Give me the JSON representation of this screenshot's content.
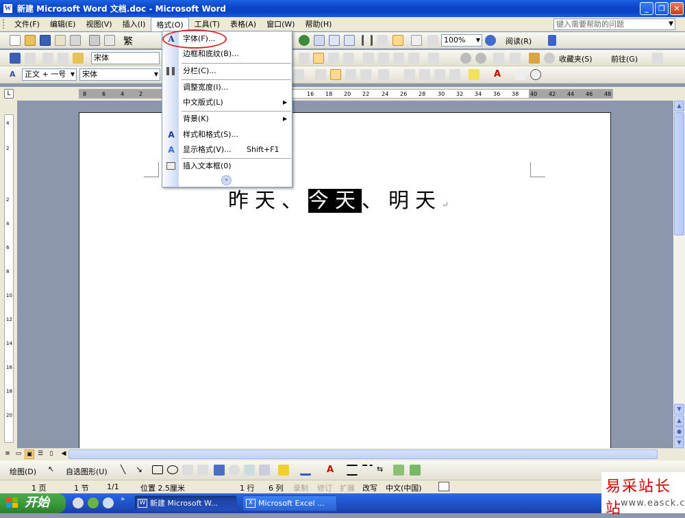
{
  "window": {
    "title": "新建 Microsoft Word 文档.doc - Microsoft Word",
    "minimize": "_",
    "maximize": "❐",
    "close": "✕"
  },
  "menubar": {
    "items": [
      "文件(F)",
      "编辑(E)",
      "视图(V)",
      "插入(I)",
      "格式(O)",
      "工具(T)",
      "表格(A)",
      "窗口(W)",
      "帮助(H)"
    ],
    "help_search_placeholder": "键入需要帮助的问题"
  },
  "toolbar_standard": {
    "zoom": "100%",
    "read_label": "阅读(R)",
    "trad_chinese": "繁"
  },
  "toolbar_formatting": {
    "font": "宋体",
    "favorites": "收藏夹(S)",
    "goto": "前往(G)"
  },
  "toolbar_styles": {
    "style": "正文 + 一号",
    "font": "宋体"
  },
  "format_menu": {
    "items": [
      {
        "label": "字体(F)...",
        "icon": "font-A-icon",
        "shortcut": ""
      },
      {
        "label": "边框和底纹(B)...",
        "icon": "",
        "shortcut": ""
      },
      {
        "label": "分栏(C)...",
        "icon": "columns-icon",
        "shortcut": ""
      },
      {
        "label": "调整宽度(I)...",
        "icon": "",
        "shortcut": ""
      },
      {
        "label": "中文版式(L)",
        "icon": "",
        "shortcut": "",
        "submenu": true
      },
      {
        "label": "背景(K)",
        "icon": "",
        "shortcut": "",
        "submenu": true
      },
      {
        "label": "样式和格式(S)...",
        "icon": "styles-icon",
        "shortcut": ""
      },
      {
        "label": "显示格式(V)...",
        "icon": "reveal-formatting-icon",
        "shortcut": "Shift+F1"
      },
      {
        "label": "插入文本框(0)",
        "icon": "textbox-icon",
        "shortcut": ""
      }
    ]
  },
  "ruler": {
    "numbers": [
      "8",
      "6",
      "4",
      "2",
      "16",
      "18",
      "20",
      "22",
      "24",
      "26",
      "28",
      "30",
      "32",
      "34",
      "36",
      "38",
      "40",
      "42",
      "44",
      "46",
      "48"
    ],
    "vertical_numbers": [
      "4",
      "2",
      "2",
      "4",
      "6",
      "8",
      "10",
      "12",
      "14",
      "16",
      "18",
      "20"
    ]
  },
  "document": {
    "text_before": "昨天、",
    "text_selected": "今天",
    "text_after": "、明天",
    "paragraph_mark": "↵"
  },
  "drawing_toolbar": {
    "draw": "绘图(D)",
    "autoshapes": "自选图形(U)"
  },
  "statusbar": {
    "page": "1 页",
    "section": "1 节",
    "pages": "1/1",
    "position": "位置 2.5厘米",
    "line": "1 行",
    "column": "6 列",
    "rec": "录制",
    "trk": "修订",
    "ext": "扩展",
    "ovr": "改写",
    "language": "中文(中国)"
  },
  "taskbar": {
    "start": "开始",
    "tasks": [
      "新建 Microsoft W...",
      "Microsoft Excel ..."
    ]
  },
  "watermark": {
    "name": "易采站长站",
    "url": "www.easck.com"
  },
  "colors": {
    "title_blue": "#0a45c8",
    "menu_highlight_oval": "#d42a2a",
    "selection": "#000000",
    "taskbar_blue": "#245edc",
    "start_green": "#3c9b3c"
  }
}
